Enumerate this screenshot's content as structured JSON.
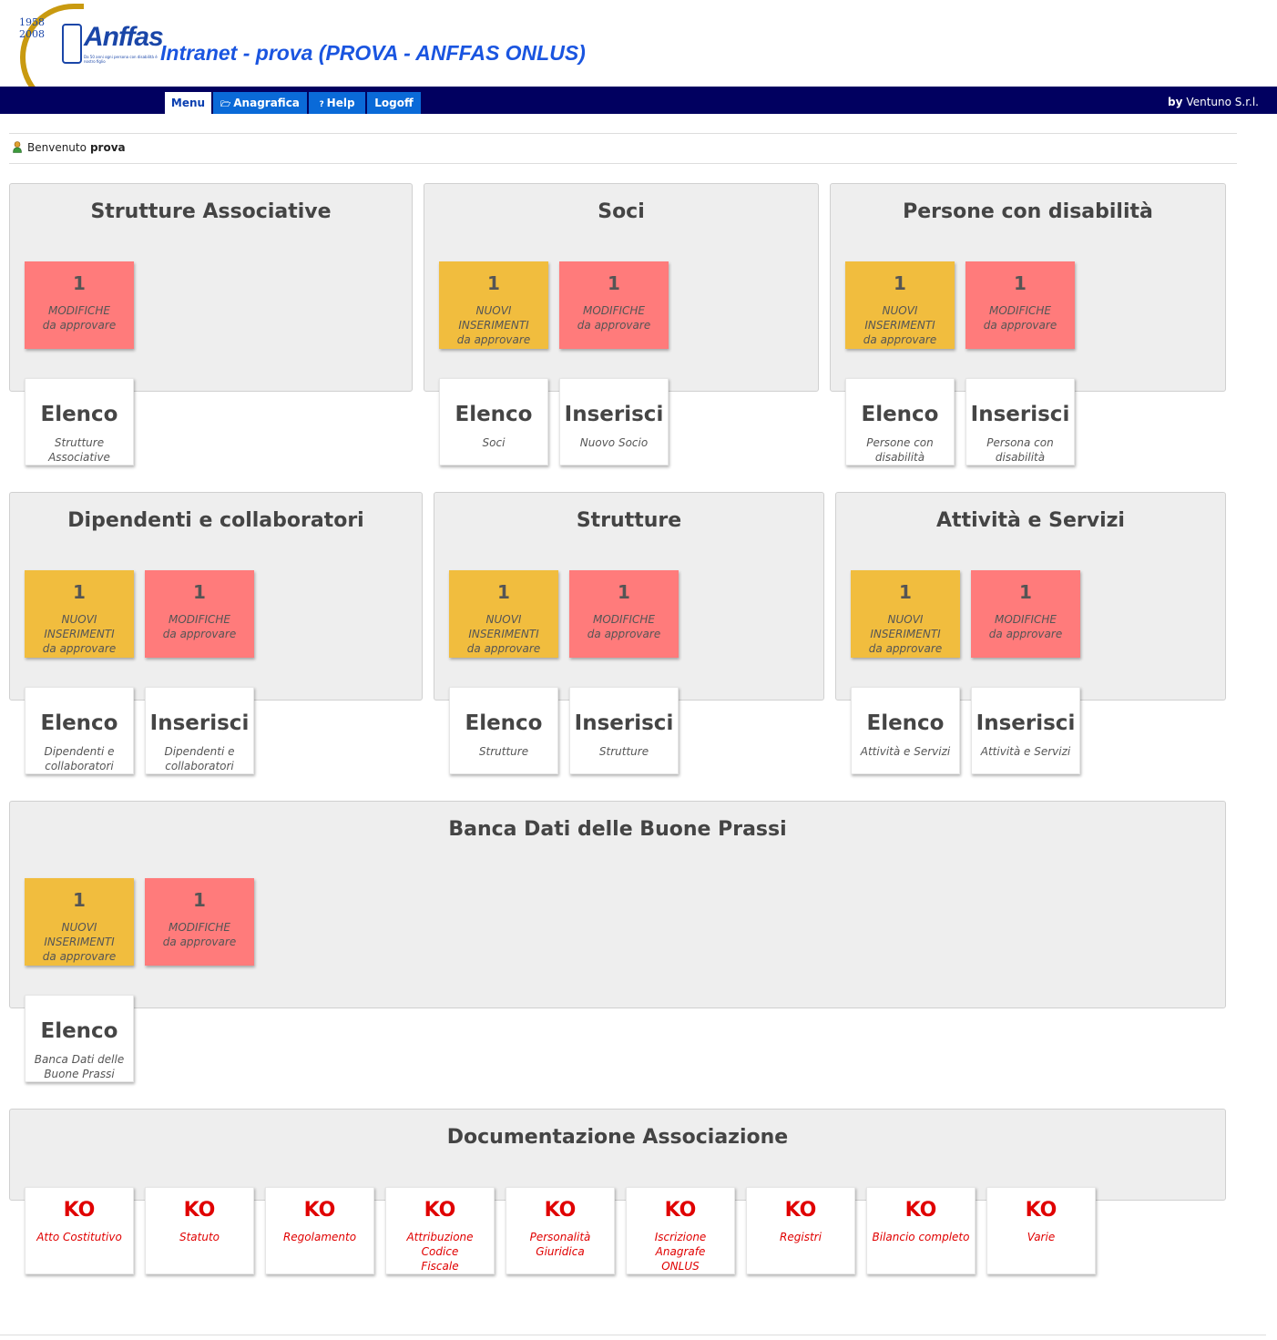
{
  "header": {
    "logo": {
      "year_start": "1958",
      "year_end": "2008",
      "wordmark": "Anffas",
      "tagline": "Da 50 anni ogni persona con disabilità è nostro figlio"
    },
    "title": "Intranet - prova (PROVA - ANFFAS ONLUS)"
  },
  "nav": {
    "tabs": [
      {
        "label": "Menu"
      },
      {
        "label": "Anagrafica"
      },
      {
        "label": "Help",
        "icon_text": "?"
      },
      {
        "label": "Logoff"
      }
    ],
    "by_label": "by",
    "by_value": "Ventuno S.r.l."
  },
  "welcome": {
    "prefix": "Benvenuto",
    "user": "prova"
  },
  "sections": [
    {
      "title": "Strutture Associative",
      "stats": [
        {
          "count": "1",
          "l1": "MODIFICHE",
          "l2": "da approvare"
        }
      ],
      "actions": [
        {
          "title": "Elenco",
          "l1": "Strutture",
          "l2": "Associative"
        }
      ]
    },
    {
      "title": "Soci",
      "stats": [
        {
          "count": "1",
          "l1": "NUOVI",
          "l2": "INSERIMENTI",
          "l3": "da approvare"
        },
        {
          "count": "1",
          "l1": "MODIFICHE",
          "l2": "da approvare"
        }
      ],
      "actions": [
        {
          "title": "Elenco",
          "l1": "Soci"
        },
        {
          "title": "Inserisci",
          "l1": "Nuovo Socio"
        }
      ]
    },
    {
      "title": "Persone con disabilità",
      "stats": [
        {
          "count": "1",
          "l1": "NUOVI",
          "l2": "INSERIMENTI",
          "l3": "da approvare"
        },
        {
          "count": "1",
          "l1": "MODIFICHE",
          "l2": "da approvare"
        }
      ],
      "actions": [
        {
          "title": "Elenco",
          "l1": "Persone con",
          "l2": "disabilità"
        },
        {
          "title": "Inserisci",
          "l1": "Persona con",
          "l2": "disabilità"
        }
      ]
    },
    {
      "title": "Dipendenti e collaboratori",
      "stats": [
        {
          "count": "1",
          "l1": "NUOVI",
          "l2": "INSERIMENTI",
          "l3": "da approvare"
        },
        {
          "count": "1",
          "l1": "MODIFICHE",
          "l2": "da approvare"
        }
      ],
      "actions": [
        {
          "title": "Elenco",
          "l1": "Dipendenti e",
          "l2": "collaboratori"
        },
        {
          "title": "Inserisci",
          "l1": "Dipendenti e",
          "l2": "collaboratori"
        }
      ]
    },
    {
      "title": "Strutture",
      "stats": [
        {
          "count": "1",
          "l1": "NUOVI",
          "l2": "INSERIMENTI",
          "l3": "da approvare"
        },
        {
          "count": "1",
          "l1": "MODIFICHE",
          "l2": "da approvare"
        }
      ],
      "actions": [
        {
          "title": "Elenco",
          "l1": "Strutture"
        },
        {
          "title": "Inserisci",
          "l1": "Strutture"
        }
      ]
    },
    {
      "title": "Attività e Servizi",
      "stats": [
        {
          "count": "1",
          "l1": "NUOVI",
          "l2": "INSERIMENTI",
          "l3": "da approvare"
        },
        {
          "count": "1",
          "l1": "MODIFICHE",
          "l2": "da approvare"
        }
      ],
      "actions": [
        {
          "title": "Elenco",
          "l1": "Attività e Servizi"
        },
        {
          "title": "Inserisci",
          "l1": "Attività e Servizi"
        }
      ]
    },
    {
      "title": "Banca Dati delle Buone Prassi",
      "stats": [
        {
          "count": "1",
          "l1": "NUOVI",
          "l2": "INSERIMENTI",
          "l3": "da approvare"
        },
        {
          "count": "1",
          "l1": "MODIFICHE",
          "l2": "da approvare"
        }
      ],
      "actions": [
        {
          "title": "Elenco",
          "l1": "Banca Dati delle",
          "l2": "Buone Prassi"
        }
      ]
    },
    {
      "title": "Documentazione Associazione",
      "docs": [
        {
          "status": "KO",
          "l1": "Atto Costitutivo"
        },
        {
          "status": "KO",
          "l1": "Statuto"
        },
        {
          "status": "KO",
          "l1": "Regolamento"
        },
        {
          "status": "KO",
          "l1": "Attribuzione Codice",
          "l2": "Fiscale"
        },
        {
          "status": "KO",
          "l1": "Personalità Giuridica"
        },
        {
          "status": "KO",
          "l1": "Iscrizione Anagrafe",
          "l2": "ONLUS"
        },
        {
          "status": "KO",
          "l1": "Registri"
        },
        {
          "status": "KO",
          "l1": "Bilancio completo"
        },
        {
          "status": "KO",
          "l1": "Varie"
        }
      ]
    }
  ],
  "colors": {
    "navbar": "#010060",
    "tab": "#0a6ad8",
    "new_tile": "#f1bd3e",
    "edit_tile": "#ff7b7b",
    "ko": "#e00000",
    "title": "#1a55e0"
  }
}
